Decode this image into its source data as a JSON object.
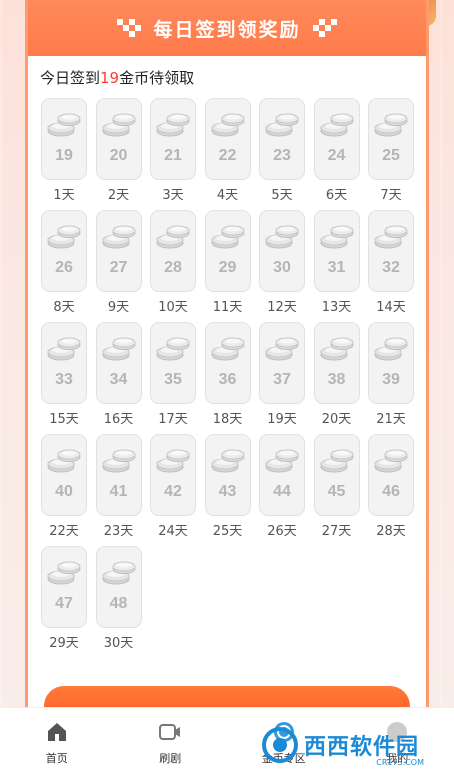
{
  "header": {
    "title": "每日签到领奖励"
  },
  "status": {
    "prefix": "今日签到",
    "amount": "19",
    "suffix": "金币待领取"
  },
  "days": [
    {
      "amount": "19",
      "label": "1天"
    },
    {
      "amount": "20",
      "label": "2天"
    },
    {
      "amount": "21",
      "label": "3天"
    },
    {
      "amount": "22",
      "label": "4天"
    },
    {
      "amount": "23",
      "label": "5天"
    },
    {
      "amount": "24",
      "label": "6天"
    },
    {
      "amount": "25",
      "label": "7天"
    },
    {
      "amount": "26",
      "label": "8天"
    },
    {
      "amount": "27",
      "label": "9天"
    },
    {
      "amount": "28",
      "label": "10天"
    },
    {
      "amount": "29",
      "label": "11天"
    },
    {
      "amount": "30",
      "label": "12天"
    },
    {
      "amount": "31",
      "label": "13天"
    },
    {
      "amount": "32",
      "label": "14天"
    },
    {
      "amount": "33",
      "label": "15天"
    },
    {
      "amount": "34",
      "label": "16天"
    },
    {
      "amount": "35",
      "label": "17天"
    },
    {
      "amount": "36",
      "label": "18天"
    },
    {
      "amount": "37",
      "label": "19天"
    },
    {
      "amount": "38",
      "label": "20天"
    },
    {
      "amount": "39",
      "label": "21天"
    },
    {
      "amount": "40",
      "label": "22天"
    },
    {
      "amount": "41",
      "label": "23天"
    },
    {
      "amount": "42",
      "label": "24天"
    },
    {
      "amount": "43",
      "label": "25天"
    },
    {
      "amount": "44",
      "label": "26天"
    },
    {
      "amount": "45",
      "label": "27天"
    },
    {
      "amount": "46",
      "label": "28天"
    },
    {
      "amount": "47",
      "label": "29天"
    },
    {
      "amount": "48",
      "label": "30天"
    }
  ],
  "tabbar": {
    "items": [
      {
        "label": "首页",
        "icon": "home-icon"
      },
      {
        "label": "刷剧",
        "icon": "video-icon"
      },
      {
        "label": "金币专区",
        "icon": "coin-zone-icon"
      },
      {
        "label": "我的",
        "icon": "profile-icon"
      }
    ]
  },
  "watermark": {
    "text": "西西软件园",
    "sub": "CR173.COM"
  },
  "colors": {
    "accent": "#ff7a4a",
    "highlight": "#ff3b2f",
    "tile_bg": "#f3f3f3",
    "tile_text": "#b5b5b5"
  }
}
